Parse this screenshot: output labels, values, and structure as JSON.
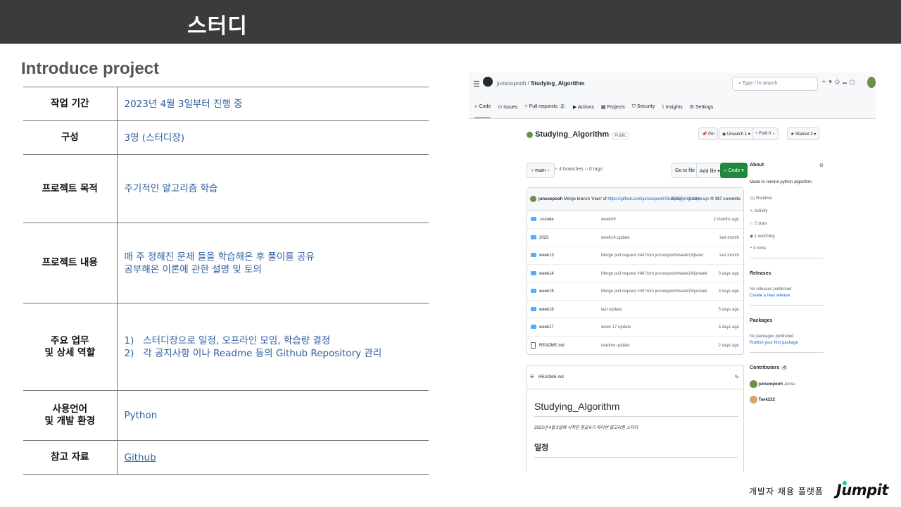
{
  "header": {
    "title": "스터디"
  },
  "section_title": "Introduce project",
  "table": [
    {
      "label": "작업 기간",
      "value_lines": [
        "2023년 4월 3일부터 진행 중"
      ]
    },
    {
      "label": "구성",
      "value_lines": [
        "3명 (스터디장)"
      ]
    },
    {
      "label": "프로젝트 목적",
      "value_lines": [
        "주기적인 알고리즘 학습"
      ]
    },
    {
      "label": "프로젝트 내용",
      "value_lines": [
        "매 주 정해진 문제 들을 학습해온 후 풀이를 공유",
        "공부해온 이론에 관한 설명 및 토의"
      ]
    },
    {
      "label_lines": [
        "주요 업무",
        "및 상세 역할"
      ],
      "value_lines": [
        "1)   스터디장으로 일정, 오프라인 모임, 학습량 결정",
        "2)   각 공지사항 이나 Readme 등의 Github Repository 관리"
      ]
    },
    {
      "label_lines": [
        "사용언어",
        "및 개발 환경"
      ],
      "value_lines": [
        "Python"
      ]
    },
    {
      "label": "참고 자료",
      "link": "Github"
    }
  ],
  "github": {
    "owner": "junsoopooh",
    "repo": "Studying_Algorithm",
    "search_placeholder": "Type / to search",
    "tabs": [
      {
        "label": "Code"
      },
      {
        "label": "Issues"
      },
      {
        "label": "Pull requests",
        "count": "2"
      },
      {
        "label": "Actions"
      },
      {
        "label": "Projects"
      },
      {
        "label": "Security"
      },
      {
        "label": "Insights"
      },
      {
        "label": "Settings"
      }
    ],
    "visibility": "Public",
    "buttons": {
      "pin": "Pin",
      "unwatch": "Unwatch",
      "unwatch_count": "1",
      "fork": "Fork",
      "fork_count": "0",
      "star": "Starred",
      "star_count": "2"
    },
    "branch": "main",
    "branches": "4 branches",
    "tags": "0 tags",
    "goto_file": "Go to file",
    "add_file": "Add file",
    "code_btn": "Code",
    "commit": {
      "author": "junsoopooh",
      "message": "Merge branch 'main' of",
      "link": "https://github.com/junsoopooh/Studying_Algorithm",
      "hash": "859586",
      "time": "2 days ago",
      "count": "367 commits"
    },
    "files": [
      {
        "name": ".vscode",
        "type": "dir",
        "commit": "week09",
        "time": "2 months ago"
      },
      {
        "name": "2023",
        "type": "dir",
        "commit": "week14 update",
        "time": "last month"
      },
      {
        "name": "week13",
        "type": "dir",
        "commit": "Merge pull request #44 from junsoopooh/week13/jiwon",
        "time": "last month"
      },
      {
        "name": "week14",
        "type": "dir",
        "commit": "Merge pull request #46 from junsoopooh/week14/juntaek",
        "time": "3 days ago"
      },
      {
        "name": "week15",
        "type": "dir",
        "commit": "Merge pull request #49 from junsoopooh/week15/juntaek",
        "time": "3 days ago"
      },
      {
        "name": "week16",
        "type": "dir",
        "commit": "last update",
        "time": "5 days ago"
      },
      {
        "name": "week17",
        "type": "dir",
        "commit": "week 17 update",
        "time": "5 days ago"
      },
      {
        "name": "README.md",
        "type": "file",
        "commit": "readme update",
        "time": "2 days ago"
      }
    ],
    "readme": {
      "filename": "README.md",
      "title": "Studying_Algorithm",
      "desc": "2023년 4월 3일에 시작된 정글 6기 파이썬 알고리즘 스터디",
      "h2": "일정"
    },
    "about": {
      "heading": "About",
      "desc": "Made to remind python algorithm.",
      "readme": "Readme",
      "activity": "Activity",
      "stars": "2 stars",
      "watching": "1 watching",
      "forks": "0 forks",
      "releases_h": "Releases",
      "releases_none": "No releases published",
      "releases_link": "Create a new release",
      "packages_h": "Packages",
      "packages_none": "No packages published",
      "packages_link": "Publish your first package",
      "contributors_h": "Contributors",
      "contributors_count": "4",
      "contrib1": "junsoopooh",
      "contrib1_sub": "Junsu",
      "contrib2": "Taek222"
    }
  },
  "footer": {
    "text": "개발자 채용 플랫폼",
    "logo": "Jumpit"
  },
  "colors": {
    "header_bg": "#3b3b3b",
    "value_text": "#2f5f9e",
    "code_button": "#1f883d",
    "logo_dot": "#00dd6d"
  }
}
